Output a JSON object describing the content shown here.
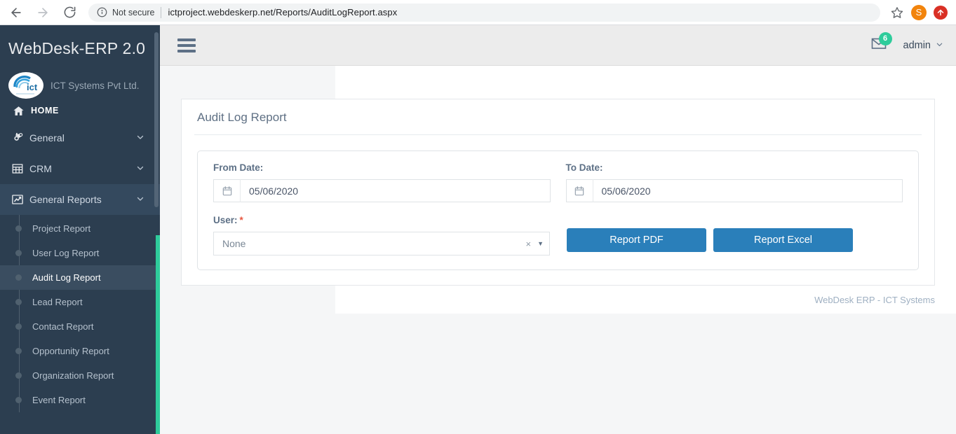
{
  "browser": {
    "back_icon": "back-arrow-icon",
    "forward_icon": "forward-arrow-icon",
    "reload_icon": "reload-icon",
    "info_icon": "info-circle-icon",
    "security_label": "Not secure",
    "url": "ictproject.webdeskerp.net/Reports/AuditLogReport.aspx",
    "star_icon": "bookmark-star-icon",
    "profile_initial": "S",
    "profile_color": "#f2840c",
    "update_icon": "update-arrow-icon",
    "update_color": "#d93025"
  },
  "sidebar": {
    "brand_title": "WebDesk-ERP 2.0",
    "company_name": "ICT Systems Pvt Ltd.",
    "logo_text": "ict",
    "accent_color": "#2ecc9b",
    "background_color": "#2c3e50",
    "home": {
      "label": "HOME",
      "icon": "home-icon"
    },
    "items": [
      {
        "label": "General",
        "icon": "gears-icon",
        "chevron": "⌄"
      },
      {
        "label": "CRM",
        "icon": "table-grid-icon",
        "chevron": "⌄"
      },
      {
        "label": "General Reports",
        "icon": "chart-line-icon",
        "chevron": "⌄"
      }
    ],
    "submenu": [
      {
        "label": "Project Report"
      },
      {
        "label": "User Log Report"
      },
      {
        "label": "Audit Log Report"
      },
      {
        "label": "Lead Report"
      },
      {
        "label": "Contact Report"
      },
      {
        "label": "Opportunity Report"
      },
      {
        "label": "Organization Report"
      },
      {
        "label": "Event Report"
      }
    ],
    "active_submenu": "Audit Log Report"
  },
  "topbar": {
    "menu_toggle_icon": "hamburger-icon",
    "mail_icon": "envelope-icon",
    "mail_badge_count": "6",
    "mail_badge_color": "#2ecc9b",
    "user_label": "admin",
    "user_chevron": "⌄"
  },
  "main": {
    "panel_title": "Audit Log Report",
    "from_date": {
      "label": "From Date:",
      "value": "05/06/2020",
      "icon": "calendar-icon"
    },
    "to_date": {
      "label": "To Date:",
      "value": "05/06/2020",
      "icon": "calendar-icon"
    },
    "user_field": {
      "label": "User:",
      "required_marker": "*",
      "value": "None",
      "clear_glyph": "×",
      "caret_glyph": "▼"
    },
    "buttons": {
      "pdf_label": "Report PDF",
      "excel_label": "Report Excel",
      "color": "#2a7fba"
    }
  },
  "footer": {
    "text": "WebDesk ERP - ICT Systems"
  }
}
